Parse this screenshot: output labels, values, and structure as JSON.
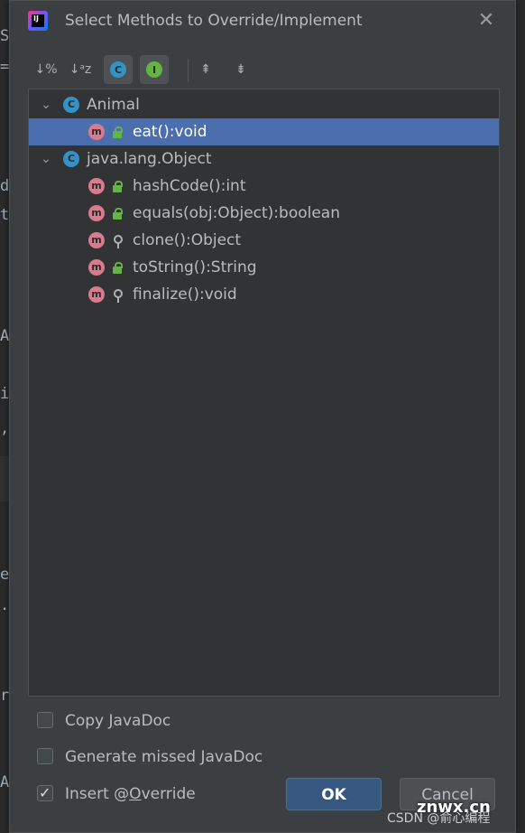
{
  "editor_behind": {
    "chars": [
      "S",
      "=",
      "d",
      "t",
      "A",
      "i",
      ",",
      "e",
      ".",
      "r",
      "A"
    ]
  },
  "dialog": {
    "title": "Select Methods to Override/Implement",
    "app_icon_text": "IJ"
  },
  "toolbar": {
    "sort_by_visibility": "↓%",
    "sort_alpha": "↓ᵃz",
    "show_classes": "C",
    "show_interfaces": "I",
    "expand_all": "⇞",
    "collapse_all": "⇟"
  },
  "tree": {
    "groups": [
      {
        "label": "Animal",
        "icon": "C",
        "expanded": true,
        "methods": [
          {
            "label": "eat():void",
            "visibility": "public",
            "selected": true
          }
        ]
      },
      {
        "label": "java.lang.Object",
        "icon": "C",
        "expanded": true,
        "methods": [
          {
            "label": "hashCode():int",
            "visibility": "public",
            "selected": false
          },
          {
            "label": "equals(obj:Object):boolean",
            "visibility": "public",
            "selected": false
          },
          {
            "label": "clone():Object",
            "visibility": "protected",
            "selected": false
          },
          {
            "label": "toString():String",
            "visibility": "public",
            "selected": false
          },
          {
            "label": "finalize():void",
            "visibility": "protected",
            "selected": false
          }
        ]
      }
    ],
    "method_icon": "m"
  },
  "options": {
    "copy_javadoc": {
      "pre": "Copy ",
      "mnemonic": "J",
      "post": "avaDoc",
      "checked": false
    },
    "generate_missed_javadoc": {
      "label": "Generate missed JavaDoc",
      "checked": false
    },
    "insert_override": {
      "pre": "Insert @",
      "mnemonic": "O",
      "post": "verride",
      "checked": true
    }
  },
  "buttons": {
    "ok": "OK",
    "cancel": "Cancel"
  },
  "watermark": {
    "big": "znwx.cn",
    "small": "CSDN @俞心编程"
  },
  "colors": {
    "dialog_bg": "#3c3f41",
    "tree_bg": "#313335",
    "selection": "#4b6eaf",
    "class_icon": "#3592c4",
    "method_icon": "#d87b8e",
    "public_lock": "#62b543",
    "ok_button": "#365880"
  }
}
